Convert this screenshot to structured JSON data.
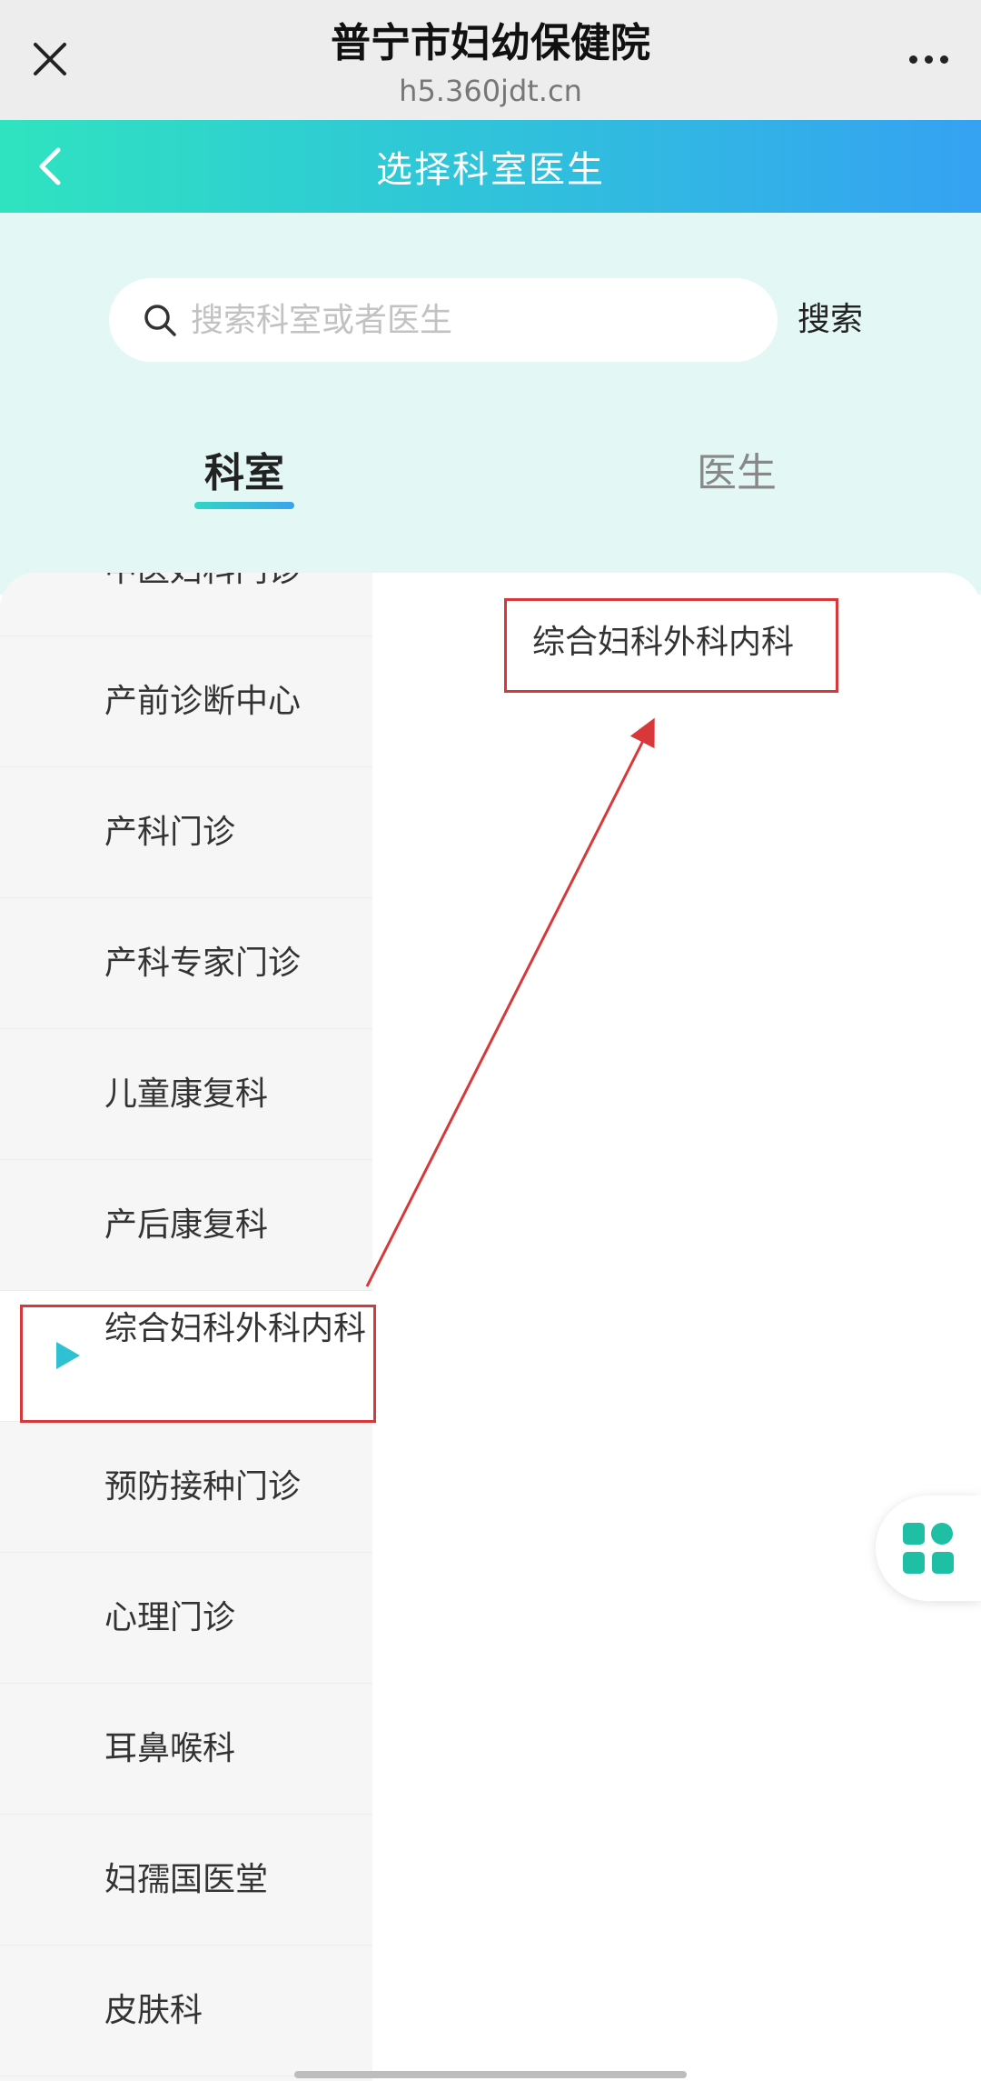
{
  "browser": {
    "title": "普宁市妇幼保健院",
    "url": "h5.360jdt.cn",
    "close_icon": "close-icon",
    "more_icon": "more-dots-icon"
  },
  "header": {
    "title": "选择科室医生",
    "back_icon": "chevron-left-icon"
  },
  "search": {
    "placeholder": "搜索科室或者医生",
    "value": "",
    "button_label": "搜索",
    "icon": "search-icon"
  },
  "tabs": [
    {
      "label": "科室",
      "active": true
    },
    {
      "label": "医生",
      "active": false
    }
  ],
  "departments": [
    {
      "label": "中医妇科门诊"
    },
    {
      "label": "产前诊断中心"
    },
    {
      "label": "产科门诊"
    },
    {
      "label": "产科专家门诊"
    },
    {
      "label": "儿童康复科"
    },
    {
      "label": "产后康复科"
    },
    {
      "label": "综合妇科外科内科",
      "active": true
    },
    {
      "label": "预防接种门诊"
    },
    {
      "label": "心理门诊"
    },
    {
      "label": "耳鼻喉科"
    },
    {
      "label": "妇孺国医堂"
    },
    {
      "label": "皮肤科"
    }
  ],
  "sub_departments": [
    {
      "label": "综合妇科外科内科"
    }
  ],
  "floating_button": {
    "icon": "grid-apps-icon"
  },
  "colors": {
    "accent": "#2fc6d8",
    "annotation": "#d9383a"
  }
}
